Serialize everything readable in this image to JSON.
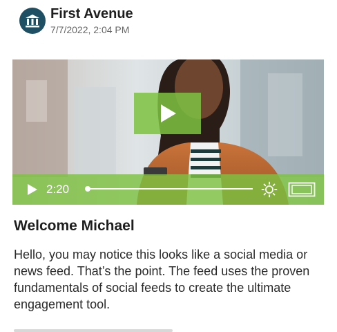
{
  "post": {
    "author": "First Avenue",
    "timestamp": "7/7/2022, 2:04 PM",
    "avatar_icon": "bank-icon",
    "title": "Welcome Michael",
    "body": "Hello, you may notice this looks like a social media or news feed. That’s the point. The feed uses the proven fundamentals of social feeds to create the ultimate engagement tool."
  },
  "video": {
    "time": "2:20",
    "progress": 0,
    "accent": "#7ec242"
  },
  "colors": {
    "avatar_bg": "#1f4f63",
    "accent": "#7ec242"
  }
}
